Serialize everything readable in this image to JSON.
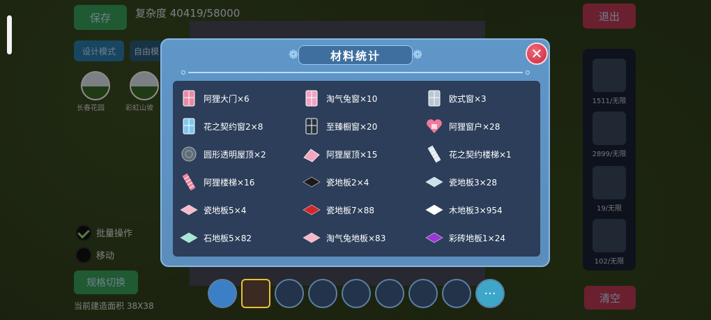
{
  "header": {
    "save_label": "保存",
    "complexity": "复杂度 40419/58000",
    "design_mode": "设计模式",
    "freedom": "自由模",
    "exit_label": "退出",
    "clear_label": "清空"
  },
  "left_panel": {
    "batch_label": "批量操作",
    "move_label": "移动",
    "switch_label": "规格切换",
    "area_label": "当前建造面积 38X38"
  },
  "modal": {
    "title": "材料统计",
    "close_icon": "close-icon",
    "materials": [
      {
        "name": "阿狸大门×6",
        "icon": "door-icon",
        "color": "#e98aa6"
      },
      {
        "name": "淘气兔窗×10",
        "icon": "curtain-window-icon",
        "color": "#f2a3c4"
      },
      {
        "name": "欧式窗×3",
        "icon": "european-window-icon",
        "color": "#b9c6d3"
      },
      {
        "name": "花之契约窗2×8",
        "icon": "flower-window-icon",
        "color": "#7fc7f0"
      },
      {
        "name": "至臻橱窗×20",
        "icon": "showcase-window-icon",
        "color": "#26323f"
      },
      {
        "name": "阿狸窗户×28",
        "icon": "heart-window-icon",
        "color": "#f07a9a"
      },
      {
        "name": "圆形透明屋顶×2",
        "icon": "round-roof-icon",
        "color": "#5f6d78"
      },
      {
        "name": "阿狸屋顶×15",
        "icon": "roof-icon",
        "color": "#f3a7bf"
      },
      {
        "name": "花之契约楼梯×1",
        "icon": "spiral-stair-icon",
        "color": "#dfe7ee"
      },
      {
        "name": "阿狸楼梯×16",
        "icon": "stair-icon",
        "color": "#ef86a3"
      },
      {
        "name": "瓷地板2×4",
        "icon": "floor-tile-icon",
        "color": "#1a1a1a"
      },
      {
        "name": "瓷地板3×28",
        "icon": "floor-tile-icon",
        "color": "#c9e3ec"
      },
      {
        "name": "瓷地板5×4",
        "icon": "floor-tile-icon",
        "color": "#f6bccb"
      },
      {
        "name": "瓷地板7×88",
        "icon": "floor-tile-icon",
        "color": "#d32626"
      },
      {
        "name": "木地板3×954",
        "icon": "floor-tile-icon",
        "color": "#ffffff"
      },
      {
        "name": "石地板5×82",
        "icon": "floor-tile-icon",
        "color": "#a6e7d6"
      },
      {
        "name": "淘气兔地板×83",
        "icon": "floor-tile-icon",
        "color": "#f7b8c8"
      },
      {
        "name": "彩砖地板1×24",
        "icon": "floor-tile-icon",
        "color": "#9b35d6"
      }
    ]
  },
  "sidebar": {
    "items": [
      {
        "label": "1511/无限"
      },
      {
        "label": "2899/无限"
      },
      {
        "label": "19/无限"
      },
      {
        "label": "102/无限"
      }
    ]
  },
  "scenes": [
    "长春花园",
    "彩虹山坡"
  ]
}
